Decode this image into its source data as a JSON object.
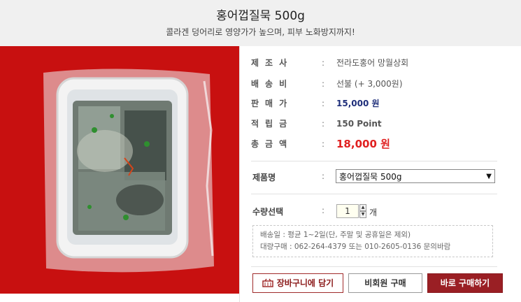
{
  "header": {
    "title": "홍어껍질묵 500g",
    "subtitle": "콜라겐 덩어리로 영양가가 높으며, 피부 노화방지까지!"
  },
  "product_info": [
    {
      "label": "제조사",
      "value": "전라도홍어 망월상회"
    },
    {
      "label": "배송비",
      "value": "선불 (+ 3,000원)"
    },
    {
      "label": "판매가",
      "value": "15,000 원"
    },
    {
      "label": "적립금",
      "value": "150 Point"
    },
    {
      "label": "총금액",
      "value": "18,000 원"
    }
  ],
  "colon": ":",
  "option": {
    "label": "제품명",
    "selected": "홍어껍질묵 500g"
  },
  "quantity": {
    "label": "수량선택",
    "value": "1",
    "unit": "개"
  },
  "notice": {
    "line1": "배송일 : 평균 1~2일(단, 주말 및 공휴일은 제외)",
    "line2": "대량구매 : 062-264-4379 또는 010-2605-0136 문의바람"
  },
  "buttons": {
    "cart": "장바구니에 담기",
    "guest": "비회원 구매",
    "buy": "바로 구매하기"
  },
  "colors": {
    "header_bg": "#f0f0f0",
    "photo_bg": "#cc1010",
    "price": "#1e2e7a",
    "total": "#e02020",
    "buy_button": "#9a1f24"
  }
}
